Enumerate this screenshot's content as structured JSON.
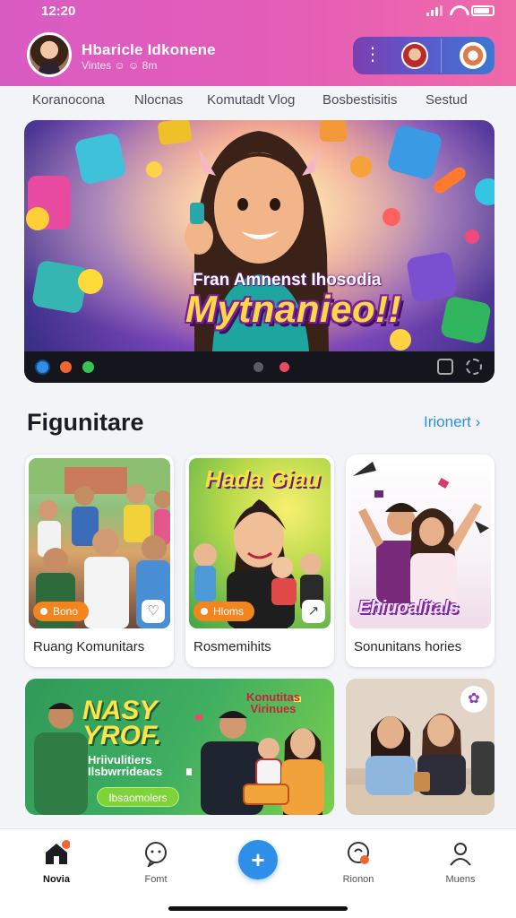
{
  "status_bar": {
    "time": "12:20"
  },
  "header": {
    "username": "Hbaricle Idkonene",
    "subtitle": "Vintes ☺ ☺ 8m"
  },
  "tabs": [
    "Koranocona",
    "Nlocnas",
    "Komutadt Vlog",
    "Bosbestisitis",
    "Sestud"
  ],
  "hero": {
    "subtitle": "Fran Amnenst Ihosodia",
    "title": "Mytnanieo!!",
    "dot_colors": [
      "#2f8fe8",
      "#f2662e",
      "#37c455"
    ],
    "page_dots": 2
  },
  "section": {
    "title": "Figunitare",
    "link": "Irionert ›"
  },
  "cards": [
    {
      "label": "Ruang Komunitars",
      "tag": "Bono"
    },
    {
      "label": "Rosmemihits",
      "tag": "Hloms",
      "overlay": "Hada Giau"
    },
    {
      "label": "Sonunitans hories",
      "overlay": "Ehiuoalitals"
    }
  ],
  "wide_card": {
    "headline_1": "NASY",
    "headline_2": "YROF.",
    "sub_1": "Hriivulitiers",
    "sub_2": "Ilsbwrrideacs",
    "button": "Ibsaomolers",
    "overlay_1": "Konutitas",
    "overlay_2": "Virinues"
  },
  "bottom_nav": [
    {
      "label": "Novia",
      "icon": "home-icon",
      "active": true
    },
    {
      "label": "Fomt",
      "icon": "chat-icon",
      "active": false
    },
    {
      "label": "",
      "icon": "add-icon",
      "active": false
    },
    {
      "label": "Rionon",
      "icon": "notification-icon",
      "active": false
    },
    {
      "label": "Muens",
      "icon": "profile-icon",
      "active": false
    }
  ],
  "colors": {
    "header_gradient_start": "#d95cc3",
    "header_gradient_end": "#f06aa9",
    "accent_blue": "#2f8fe8",
    "tag_orange": "#f2851e"
  }
}
